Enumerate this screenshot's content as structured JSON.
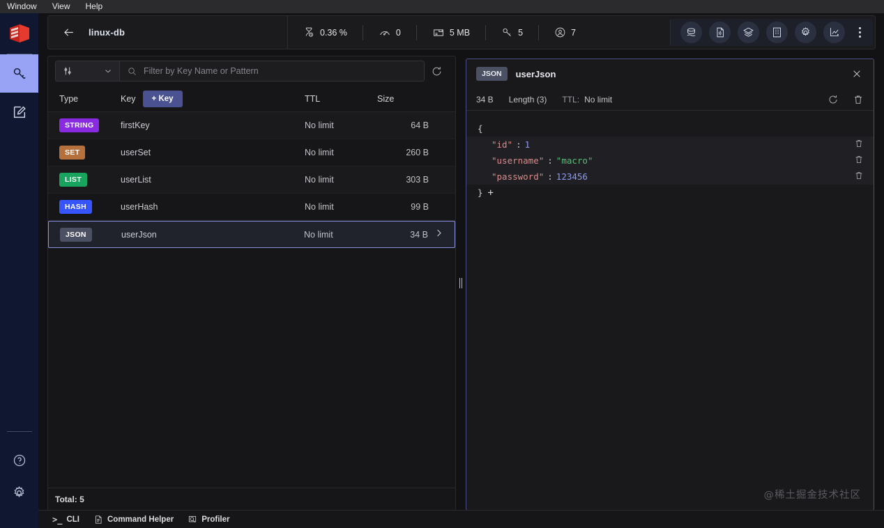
{
  "menubar": {
    "items": [
      {
        "label": "Window"
      },
      {
        "label": "View"
      },
      {
        "label": "Help"
      }
    ]
  },
  "sidebar": {
    "logo_icon": "redis-logo-icon",
    "items": [
      {
        "icon": "key-icon",
        "name": "browser",
        "active": true
      },
      {
        "icon": "edit-square-icon",
        "name": "workbench",
        "active": false
      }
    ],
    "bottom_items": [
      {
        "icon": "help-circle-icon",
        "name": "help"
      },
      {
        "icon": "gear-icon",
        "name": "settings"
      }
    ]
  },
  "topbar": {
    "back_icon": "arrow-left-icon",
    "database_name": "linux-db",
    "metrics": [
      {
        "icon": "cpu-hourglass-icon",
        "name": "cpu",
        "value": "0.36 %"
      },
      {
        "icon": "gauge-icon",
        "name": "commands-per-sec",
        "value": "0"
      },
      {
        "icon": "memory-icon",
        "name": "memory",
        "value": "5 MB"
      },
      {
        "icon": "key-icon",
        "name": "total-keys",
        "value": "5"
      },
      {
        "icon": "user-circle-icon",
        "name": "connected-clients",
        "value": "7"
      }
    ],
    "actions": [
      {
        "icon": "database-stack-icon",
        "name": "overview"
      },
      {
        "icon": "file-signal-icon",
        "name": "slow-log"
      },
      {
        "icon": "layers-icon",
        "name": "pub-sub"
      },
      {
        "icon": "cluster-grid-icon",
        "name": "cluster-details"
      },
      {
        "icon": "gear-icon",
        "name": "database-settings"
      },
      {
        "icon": "chart-line-icon",
        "name": "analysis-tools"
      }
    ],
    "kebab_icon": "more-vertical-icon"
  },
  "keys_panel": {
    "filter": {
      "selector_icon": "sliders-icon",
      "chevron_icon": "chevron-down-icon",
      "search_icon": "search-icon",
      "placeholder": "Filter by Key Name or Pattern",
      "value": "",
      "refresh_icon": "refresh-icon"
    },
    "columns": {
      "type": "Type",
      "key": "Key",
      "ttl": "TTL",
      "size": "Size"
    },
    "add_key_label": "+ Key",
    "rows": [
      {
        "type": "STRING",
        "type_color": "#8a2be2",
        "key": "firstKey",
        "ttl": "No limit",
        "size": "64 B",
        "selected": false
      },
      {
        "type": "SET",
        "type_color": "#b5703c",
        "key": "userSet",
        "ttl": "No limit",
        "size": "260 B",
        "selected": false
      },
      {
        "type": "LIST",
        "type_color": "#18a35f",
        "key": "userList",
        "ttl": "No limit",
        "size": "303 B",
        "selected": false
      },
      {
        "type": "HASH",
        "type_color": "#3655ff",
        "key": "userHash",
        "ttl": "No limit",
        "size": "99 B",
        "selected": false
      },
      {
        "type": "JSON",
        "type_color": "#4b5163",
        "key": "userJson",
        "ttl": "No limit",
        "size": "34 B",
        "selected": true
      }
    ],
    "total_label": "Total: 5"
  },
  "splitter": {
    "icon": "resize-handle-icon"
  },
  "value_panel": {
    "type_badge": "JSON",
    "key_name": "userJson",
    "close_icon": "close-icon",
    "size": "34 B",
    "length": "Length (3)",
    "ttl_label": "TTL:",
    "ttl_value": "No limit",
    "refresh_icon": "refresh-icon",
    "delete_icon": "trash-icon",
    "json": {
      "open_brace": "{",
      "close_brace": "}",
      "add_icon": "+",
      "entries": [
        {
          "key": "\"id\"",
          "colon": ":",
          "value": "1",
          "value_type": "number"
        },
        {
          "key": "\"username\"",
          "colon": ":",
          "value": "\"macro\"",
          "value_type": "string"
        },
        {
          "key": "\"password\"",
          "colon": ":",
          "value": "123456",
          "value_type": "number"
        }
      ]
    },
    "watermark": "@稀土掘金技术社区"
  },
  "bottombar": {
    "items": [
      {
        "icon": "terminal-icon",
        "label": "CLI"
      },
      {
        "icon": "document-icon",
        "label": "Command Helper"
      },
      {
        "icon": "profiler-icon",
        "label": "Profiler"
      }
    ]
  },
  "colors": {
    "accent": "#8b93e0",
    "add_key_button": "#4a5291",
    "panel_border": "#4a4f86",
    "json_key": "#d98a8a",
    "json_string": "#5fb87a",
    "json_number": "#8d9bf0"
  }
}
